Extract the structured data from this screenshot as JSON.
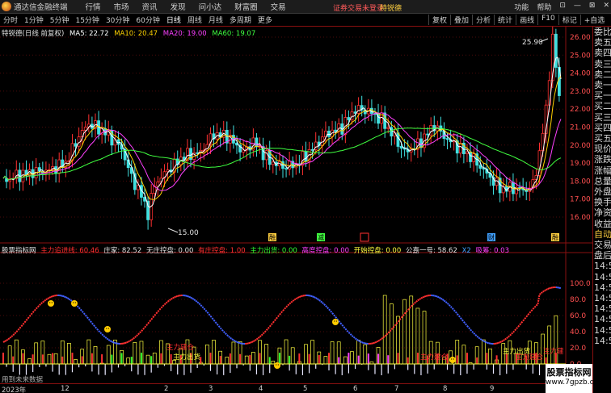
{
  "app": {
    "title": "通达信金融终端",
    "menu": [
      "行情",
      "市场",
      "资讯",
      "发现",
      "问小达",
      "财富圈",
      "交易"
    ],
    "notice": "证券交易未登录",
    "stock_name": "特锐德",
    "right_menu": [
      "功能",
      "帮助",
      "⊡",
      "—",
      "⊠",
      "✕"
    ]
  },
  "toolbar": {
    "periods": [
      "分时",
      "1分钟",
      "5分钟",
      "15分钟",
      "30分钟",
      "60分钟",
      "日线",
      "周线",
      "月线",
      "多周期",
      "更多"
    ],
    "active_period": "日线",
    "tools": [
      "复权",
      "叠加",
      "分析",
      "统计",
      "画线",
      "F10",
      "标记",
      "+自选"
    ]
  },
  "legend": {
    "title": "特锐德(日线 前复权)",
    "ma5": "MA5: 22.72",
    "ma10": "MA10: 20.47",
    "ma20": "MA20: 19.00",
    "ma60": "MA60: 19.07",
    "colors": {
      "ma5": "#ffffff",
      "ma10": "#ffd000",
      "ma20": "#ff40ff",
      "ma60": "#40ff40"
    }
  },
  "price_axis": [
    "26.00",
    "25.00",
    "24.00",
    "23.00",
    "22.00",
    "21.00",
    "20.00",
    "19.00",
    "18.00",
    "17.00",
    "16.00"
  ],
  "annotations": {
    "high": "25.90",
    "low": "15.00"
  },
  "event_markers": [
    "融",
    "减",
    "财",
    "融"
  ],
  "indicator": {
    "title": "股票指标网",
    "items": [
      {
        "label": "主力追进线: 60.46",
        "color": "#ff3030"
      },
      {
        "label": "庄家: 82.52",
        "color": "#e0e0e0"
      },
      {
        "label": "无庄控盘: 0.00",
        "color": "#e0e0e0"
      },
      {
        "label": "有庄控盘: 1.00",
        "color": "#ff3030"
      },
      {
        "label": "主力出货: 0.00",
        "color": "#30ff30"
      },
      {
        "label": "高度控盘: 0.00",
        "color": "#ff40ff"
      },
      {
        "label": "开始控盘: 0.00",
        "color": "#ffff40"
      },
      {
        "label": "公嘉一号: 58.62",
        "color": "#e0e0e0"
      },
      {
        "label": "X2",
        "color": "#40a0ff"
      },
      {
        "label": "吸筹: 0.03",
        "color": "#ff40ff"
      }
    ],
    "axis": [
      "100.0",
      "80.0",
      "60.0",
      "40.0",
      "20.0",
      "0.0"
    ],
    "labels": [
      "主力建仓",
      "主力出货",
      "主力建仓",
      "主力出货",
      "主力建仓",
      "主力建"
    ]
  },
  "right_panel": [
    {
      "t": "委比",
      "c": "normal"
    },
    {
      "t": "卖五",
      "c": "normal"
    },
    {
      "t": "卖四",
      "c": "normal"
    },
    {
      "t": "卖三",
      "c": "normal"
    },
    {
      "t": "卖二",
      "c": "normal"
    },
    {
      "t": "卖一",
      "c": "normal"
    },
    {
      "t": "买一",
      "c": "normal"
    },
    {
      "t": "买二",
      "c": "normal"
    },
    {
      "t": "买三",
      "c": "normal"
    },
    {
      "t": "买四",
      "c": "normal"
    },
    {
      "t": "买五",
      "c": "normal"
    },
    {
      "t": "现价",
      "c": "normal"
    },
    {
      "t": "涨跌",
      "c": "normal"
    },
    {
      "t": "涨幅",
      "c": "normal"
    },
    {
      "t": "总量",
      "c": "normal"
    },
    {
      "t": "外盘",
      "c": "normal"
    },
    {
      "t": "换手",
      "c": "normal"
    },
    {
      "t": "净资",
      "c": "normal"
    },
    {
      "t": "收益",
      "c": "normal"
    },
    {
      "t": "自动",
      "c": "yellow"
    },
    {
      "t": "交易",
      "c": "normal"
    },
    {
      "t": "盘后",
      "c": "normal"
    },
    {
      "t": "14:50",
      "c": "normal"
    },
    {
      "t": "14:50",
      "c": "normal"
    },
    {
      "t": "14:50",
      "c": "normal"
    },
    {
      "t": "14:50",
      "c": "normal"
    },
    {
      "t": "14:50",
      "c": "normal"
    },
    {
      "t": "14:50",
      "c": "normal"
    },
    {
      "t": "14:50",
      "c": "normal"
    },
    {
      "t": "14:50",
      "c": "normal"
    }
  ],
  "bottom_axis": [
    "2023年",
    "12",
    "2",
    "3",
    "4",
    "5",
    "6",
    "7",
    "8",
    "9"
  ],
  "no_data": "用到未来数据",
  "watermark": {
    "line1": "股票指标网",
    "line2": "www.7gpzb.com"
  }
}
